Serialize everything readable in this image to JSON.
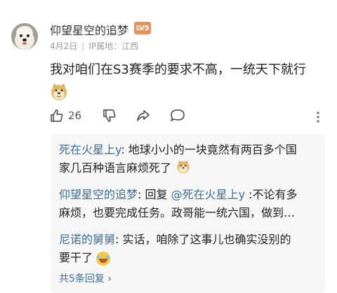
{
  "comment": {
    "username": "仰望星空的追梦",
    "level": "LV5",
    "date": "4月2日",
    "ip_location": "IP属地：江西",
    "text": "我对咱们在S3赛季的要求不高，一统天下就行",
    "likes": "26"
  },
  "replies": [
    {
      "author": "死在火星上y",
      "separator": ": ",
      "text_line1": "地球小小的一块竟然有两百多个国",
      "text_line2": "家几百种语言麻烦死了"
    },
    {
      "author": "仰望星空的追梦",
      "separator": ": ",
      "prefix": "回复 ",
      "mention": "@死在火星上y",
      "text_line1": " :不论有多",
      "text_line2": "麻烦，也要完成任务。政哥能一统六国，做到…"
    },
    {
      "author": "尼诺的舅舅",
      "separator": ": ",
      "text_line1": "实话，咱除了这事儿也确实没别的",
      "text_line2": "要干了"
    }
  ],
  "total_replies": "共5条回复 ›",
  "icons": [
    "thumbs-up-icon",
    "thumbs-down-icon",
    "share-icon",
    "comment-icon",
    "more-icon"
  ]
}
